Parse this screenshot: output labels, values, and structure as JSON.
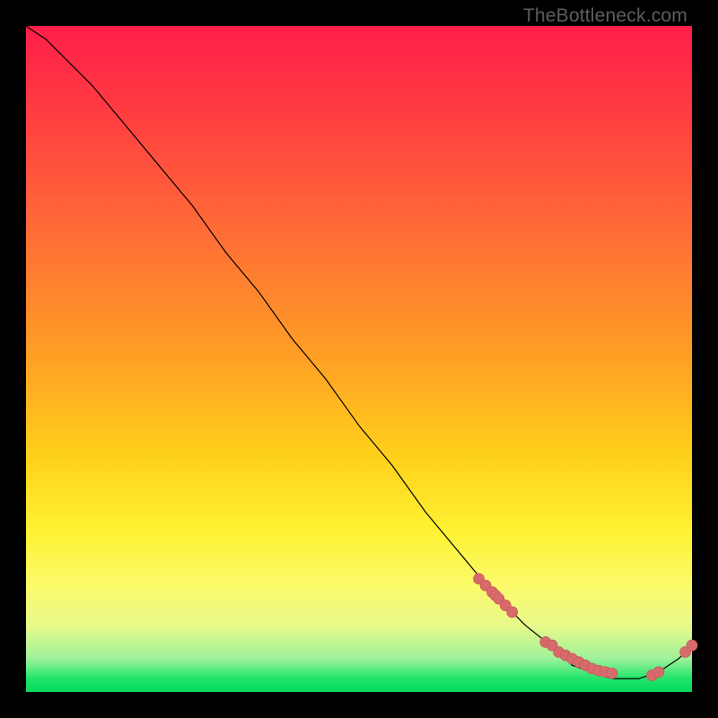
{
  "watermark": "TheBottleneck.com",
  "chart_data": {
    "type": "line",
    "title": "",
    "xlabel": "",
    "ylabel": "",
    "xlim": [
      0,
      100
    ],
    "ylim": [
      0,
      100
    ],
    "grid": false,
    "curve": {
      "x": [
        0,
        3,
        6,
        10,
        15,
        20,
        25,
        30,
        35,
        40,
        45,
        50,
        55,
        60,
        65,
        70,
        75,
        80,
        82,
        85,
        88,
        90,
        92,
        95,
        98,
        100
      ],
      "y": [
        100,
        98,
        95,
        91,
        85,
        79,
        73,
        66,
        60,
        53,
        47,
        40,
        34,
        27,
        21,
        15,
        10,
        6,
        4,
        3,
        2,
        2,
        2,
        3,
        5,
        7
      ]
    },
    "cluster_points": {
      "x": [
        68,
        69,
        70,
        70.5,
        71,
        72,
        73,
        78,
        79,
        80,
        81,
        82,
        83,
        84,
        85,
        86,
        87,
        88,
        94,
        95,
        99,
        100
      ],
      "y": [
        17,
        16,
        15,
        14.5,
        14,
        13,
        12,
        7.5,
        7,
        6,
        5.5,
        5,
        4.5,
        4,
        3.5,
        3.2,
        3,
        2.8,
        2.5,
        3,
        6,
        7
      ]
    },
    "point_color": "#d76b6b",
    "line_color": "#000000"
  }
}
